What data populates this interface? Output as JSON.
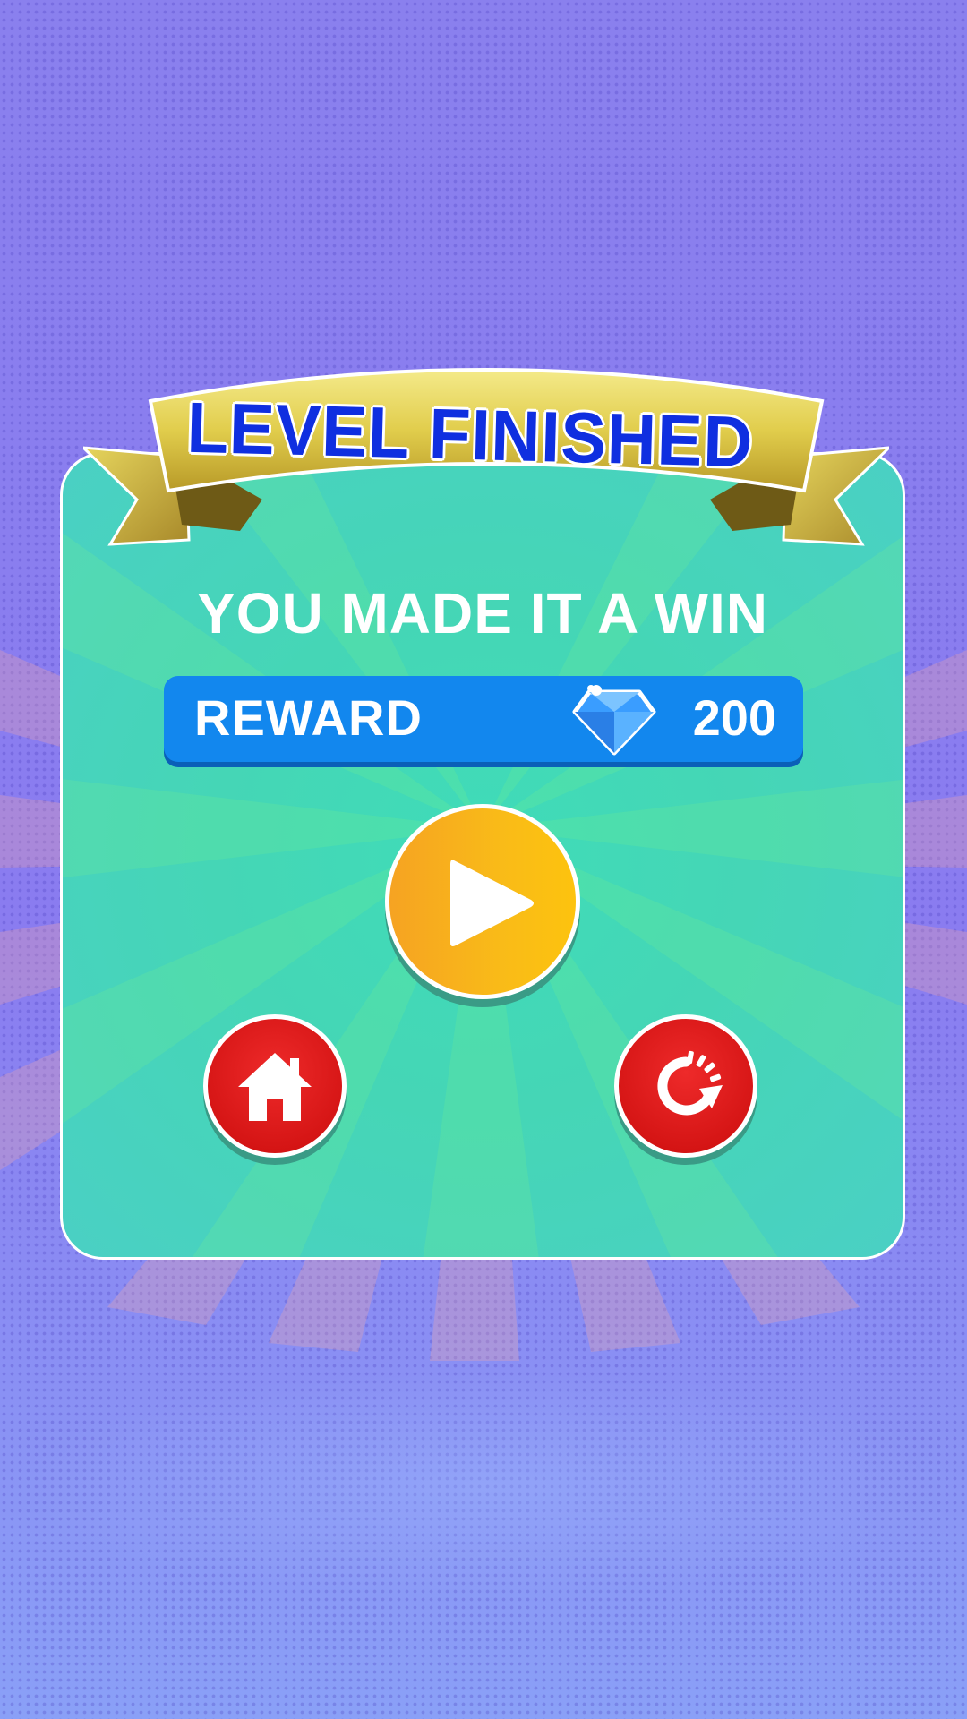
{
  "screen": {
    "title": "LEVEL FINISHED",
    "subtitle": "YOU MADE IT A WIN"
  },
  "reward": {
    "label": "REWARD",
    "icon": "gem-icon",
    "value": "200"
  },
  "buttons": {
    "play": {
      "icon": "play-icon"
    },
    "home": {
      "icon": "home-icon"
    },
    "replay": {
      "icon": "replay-icon"
    }
  },
  "colors": {
    "background": "#8a80ee",
    "panel": "#45d6b6",
    "ribbon_gold": "#e8d65a",
    "title_text": "#0f2fe0",
    "reward_bar": "#1287ee",
    "play_button": "#f9bb18",
    "secondary_buttons": "#d41414"
  }
}
